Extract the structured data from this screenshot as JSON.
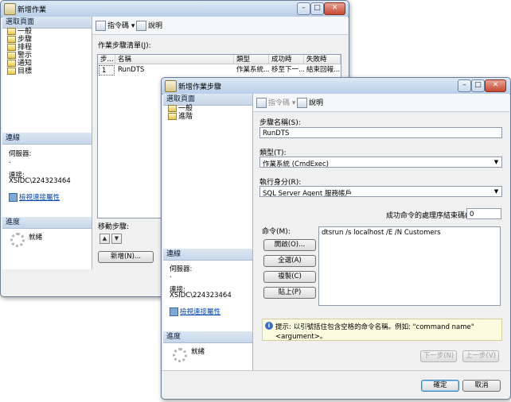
{
  "bg_window": {
    "title": "新增作業",
    "select_page_header": "選取頁面",
    "nav": [
      "一般",
      "步驟",
      "排程",
      "警示",
      "通知",
      "目標"
    ],
    "connection_header": "連線",
    "server_label": "伺服器:",
    "server_value": ".",
    "connection_label": "連接:",
    "connection_value": "XSIDC\\224323464",
    "view_conn_link": "檢視連接屬性",
    "progress_header": "進度",
    "status_text": "就緒",
    "toolbar": {
      "script": "指令碼",
      "help": "說明"
    },
    "steps_list_label": "作業步驟清單(J):",
    "grid": {
      "headers": [
        "步...",
        "名稱",
        "類型",
        "成功時",
        "失敗時"
      ],
      "rows": [
        [
          "1",
          "RunDTS",
          "作業系統...",
          "移至下一...",
          "結束回報..."
        ]
      ]
    },
    "move_step_label": "移動步驟:",
    "new_button": "新增(N)..."
  },
  "fg_window": {
    "title": "新增作業步驟",
    "select_page_header": "選取頁面",
    "nav": [
      "一般",
      "進階"
    ],
    "connection_header": "連線",
    "server_label": "伺服器:",
    "server_value": ".",
    "connection_label": "連接:",
    "connection_value": "XSIDC\\224323464",
    "view_conn_link": "檢視連接屬性",
    "progress_header": "進度",
    "status_text": "就緒",
    "toolbar": {
      "script": "指令碼",
      "help": "說明"
    },
    "step_name_label": "步驟名稱(S):",
    "step_name_value": "RunDTS",
    "type_label": "類型(T):",
    "type_value": "作業系統 (CmdExec)",
    "run_as_label": "執行身分(R):",
    "run_as_value": "SQL Server Agent 服務帳戶",
    "exit_code_label": "成功命令的處理序結束碼(X):",
    "exit_code_value": "0",
    "command_label": "命令(M):",
    "command_value": "dtsrun /s localhost /E /N Customers",
    "buttons": {
      "open": "開啟(O)...",
      "select_all": "全選(A)",
      "copy": "複製(C)",
      "paste": "貼上(P)"
    },
    "hint": "提示: 以引號括住包含空格的命令名稱。例如: \"command name\" <argument>。",
    "next_button": "下一步(N)",
    "prev_button": "上一步(V)",
    "ok_button": "確定",
    "cancel_button": "取消"
  }
}
